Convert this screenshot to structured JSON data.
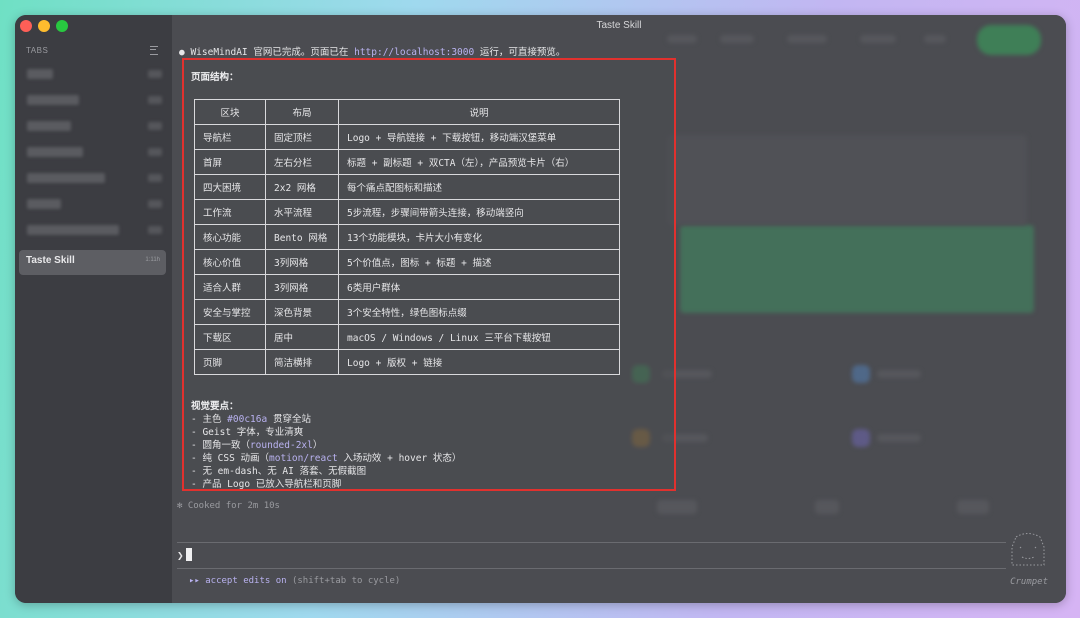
{
  "window": {
    "title": "Taste Skill"
  },
  "sidebar": {
    "header": "TABS",
    "active_tab": {
      "label": "Taste Skill",
      "time": "1:11h"
    }
  },
  "terminal": {
    "status_line": {
      "bullet": "●",
      "text": " WiseMindAI 官网已完成。页面已在 ",
      "url": "http://localhost:3000",
      "suffix": " 运行，可直接预览。"
    },
    "structure_title": "页面结构：",
    "table": {
      "headers": [
        "区块",
        "布局",
        "说明"
      ],
      "rows": [
        [
          "导航栏",
          "固定顶栏",
          "Logo + 导航链接 + 下载按钮，移动端汉堡菜单"
        ],
        [
          "首屏",
          "左右分栏",
          "标题 + 副标题 + 双CTA（左），产品预览卡片（右）"
        ],
        [
          "四大困境",
          "2x2 网格",
          "每个痛点配图标和描述"
        ],
        [
          "工作流",
          "水平流程",
          "5步流程，步骤间带箭头连接，移动端竖向"
        ],
        [
          "核心功能",
          "Bento 网格",
          "13个功能模块，卡片大小有变化"
        ],
        [
          "核心价值",
          "3列网格",
          "5个价值点，图标 + 标题 + 描述"
        ],
        [
          "适合人群",
          "3列网格",
          "6类用户群体"
        ],
        [
          "安全与掌控",
          "深色背景",
          "3个安全特性，绿色图标点缀"
        ],
        [
          "下载区",
          "居中",
          "macOS / Windows / Linux 三平台下载按钮"
        ],
        [
          "页脚",
          "简洁横排",
          "Logo + 版权 + 链接"
        ]
      ]
    },
    "visual_title": "视觉要点：",
    "visual_points": [
      {
        "pre": "- 主色 ",
        "hl": "#00c16a",
        "post": " 贯穿全站"
      },
      {
        "pre": "- Geist 字体，专业清爽",
        "hl": "",
        "post": ""
      },
      {
        "pre": "- 圆角一致（",
        "hl": "rounded-2xl",
        "post": "）"
      },
      {
        "pre": "- 纯 CSS 动画（",
        "hl": "motion/react",
        "post": " 入场动效 + hover 状态）"
      },
      {
        "pre": "- 无 em-dash、无 AI 落套、无假截图",
        "hl": "",
        "post": ""
      },
      {
        "pre": "- 产品 Logo 已放入导航栏和页脚",
        "hl": "",
        "post": ""
      }
    ],
    "cooked": "✻ Cooked for 2m 10s",
    "prompt_symbol": "❯",
    "footer": {
      "arrows": "▸▸",
      "mode": " accept edits on",
      "hint": " (shift+tab to cycle)"
    },
    "mascot_name": "Crumpet"
  }
}
